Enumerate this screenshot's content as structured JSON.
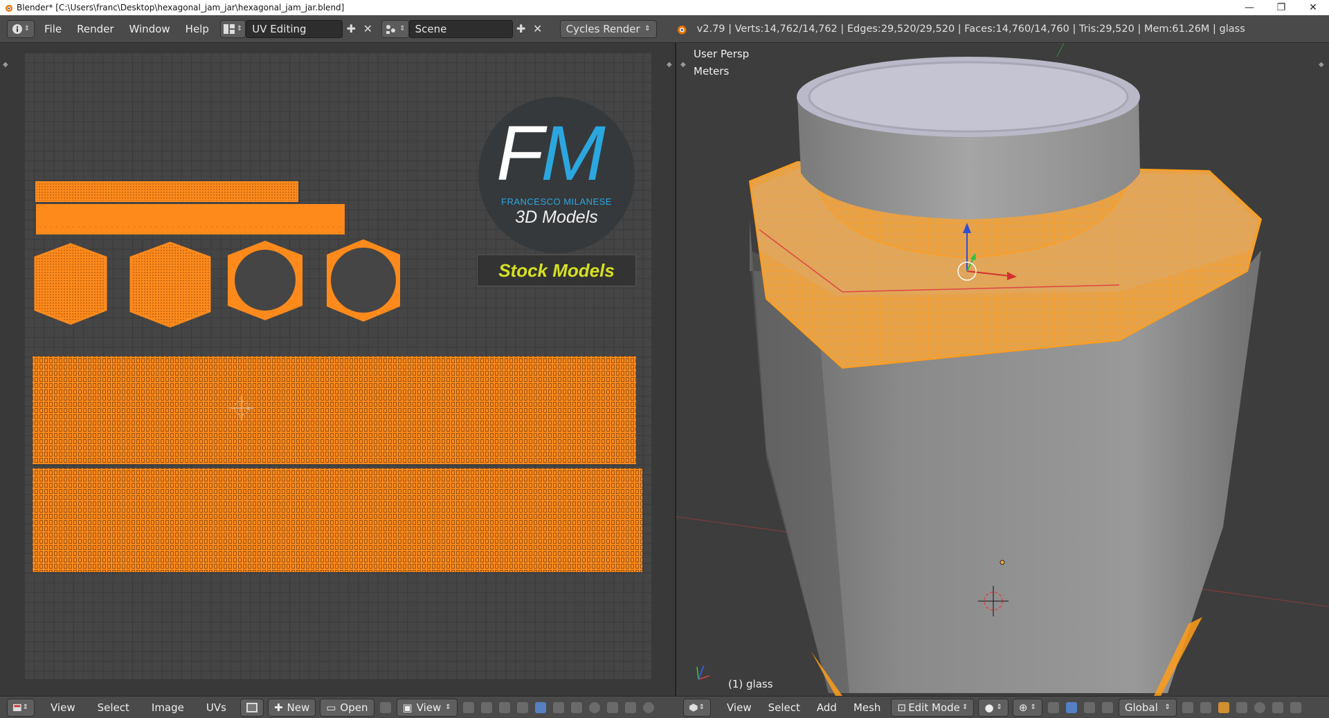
{
  "window": {
    "title": "Blender* [C:\\Users\\franc\\Desktop\\hexagonal_jam_jar\\hexagonal_jam_jar.blend]",
    "minimize": "—",
    "maximize": "❐",
    "close": "✕"
  },
  "topbar": {
    "menus": [
      "File",
      "Render",
      "Window",
      "Help"
    ],
    "layout": "UV Editing",
    "scene": "Scene",
    "engine": "Cycles Render",
    "stats": "v2.79 | Verts:14,762/14,762 | Edges:29,520/29,520 | Faces:14,760/14,760 | Tris:29,520 | Mem:61.26M | glass"
  },
  "uv_editor": {
    "logo_initials_f": "F",
    "logo_initials_m": "M",
    "logo_name": "FRANCESCO MILANESE",
    "logo_sub": "3D Models",
    "banner": "Stock Models",
    "bottom_menus": [
      "View",
      "Select",
      "Image",
      "UVs"
    ],
    "new_label": "New",
    "open_label": "Open",
    "view_label": "View"
  },
  "viewport": {
    "view_name": "User Persp",
    "units": "Meters",
    "object_label": "(1) glass",
    "bottom_menus": [
      "View",
      "Select",
      "Add",
      "Mesh"
    ],
    "mode": "Edit Mode",
    "orientation": "Global"
  },
  "colors": {
    "uv_orange": "#ff8a1c",
    "logo_blue": "#2ba7e0",
    "banner_yellow": "#d6e11f"
  }
}
